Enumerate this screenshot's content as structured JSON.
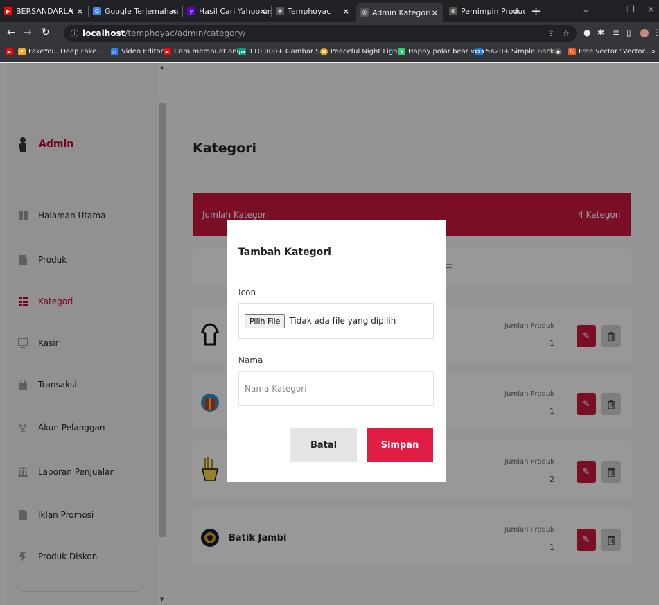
{
  "browser": {
    "tabs": [
      {
        "title": "BERSANDARLA",
        "favicon_color": "#ff0000",
        "active": false
      },
      {
        "title": "Google Terjemahan",
        "favicon_color": "#4285f4",
        "active": false
      },
      {
        "title": "Hasil Cari Yahoo un",
        "favicon_color": "#6001d2",
        "active": false
      },
      {
        "title": "Temphoyac",
        "favicon_color": "#777777",
        "active": false
      },
      {
        "title": "Admin Kategori",
        "favicon_color": "#777777",
        "active": true
      },
      {
        "title": "Pemimpin Product",
        "favicon_color": "#777777",
        "active": false
      }
    ],
    "new_tab_label": "+",
    "url_host": "localhost",
    "url_path": "/temphoyac/admin/category/",
    "bookmarks": [
      {
        "label": "",
        "color": "#ff0000"
      },
      {
        "label": "FakeYou. Deep Fake...",
        "color": "#f5a623"
      },
      {
        "label": "Video Editor",
        "color": "#2f80ed"
      },
      {
        "label": "Cara membuat ani...",
        "color": "#ff0000"
      },
      {
        "label": "110.000+ Gambar S...",
        "color": "#05a081"
      },
      {
        "label": "Peaceful Night Ligh...",
        "color": "#f39c12"
      },
      {
        "label": "Happy polar bear v...",
        "color": "#2ecc71"
      },
      {
        "label": "5420+ Simple Back...",
        "color": "#1a73e8"
      },
      {
        "label": "",
        "color": "#555555"
      },
      {
        "label": "Free vector \"Vector...",
        "color": "#ff5722"
      }
    ],
    "bookmarks_more": "»"
  },
  "sidebar": {
    "brand": "Admin",
    "items": [
      {
        "label": "Halaman Utama",
        "icon": "grid-icon",
        "active": false
      },
      {
        "label": "Produk",
        "icon": "box-icon",
        "active": false
      },
      {
        "label": "Kategori",
        "icon": "list-icon",
        "active": true
      },
      {
        "label": "Kasir",
        "icon": "monitor-icon",
        "active": false
      },
      {
        "label": "Transaksi",
        "icon": "bag-icon",
        "active": false
      },
      {
        "label": "Akun Pelanggan",
        "icon": "users-icon",
        "active": false
      },
      {
        "label": "Laporan Penjualan",
        "icon": "bank-icon",
        "active": false
      },
      {
        "label": "Iklan Promosi",
        "icon": "file-icon",
        "active": false
      },
      {
        "label": "Produk Diskon",
        "icon": "flash-icon",
        "active": false
      }
    ]
  },
  "main": {
    "title": "Kategori",
    "count_label": "Jumlah Kategori",
    "count_value": "4 Kategori",
    "categories": [
      {
        "name": "",
        "product_label": "Jumlah Produk",
        "product_count": "1"
      },
      {
        "name": "",
        "product_label": "Jumlah Produk",
        "product_count": "1"
      },
      {
        "name": "",
        "product_label": "Jumlah Produk",
        "product_count": "2"
      },
      {
        "name": "Batik Jambi",
        "product_label": "Jumlah Produk",
        "product_count": "1"
      }
    ]
  },
  "modal": {
    "title": "Tambah Kategori",
    "icon_label": "Icon",
    "file_button": "Pilih File",
    "file_status": "Tidak ada file yang dipilih",
    "name_label": "Nama",
    "name_placeholder": "Nama Kategori",
    "name_value": "",
    "cancel_label": "Batal",
    "save_label": "Simpan"
  },
  "colors": {
    "accent": "#c3183a",
    "save_button": "#e01d42"
  }
}
